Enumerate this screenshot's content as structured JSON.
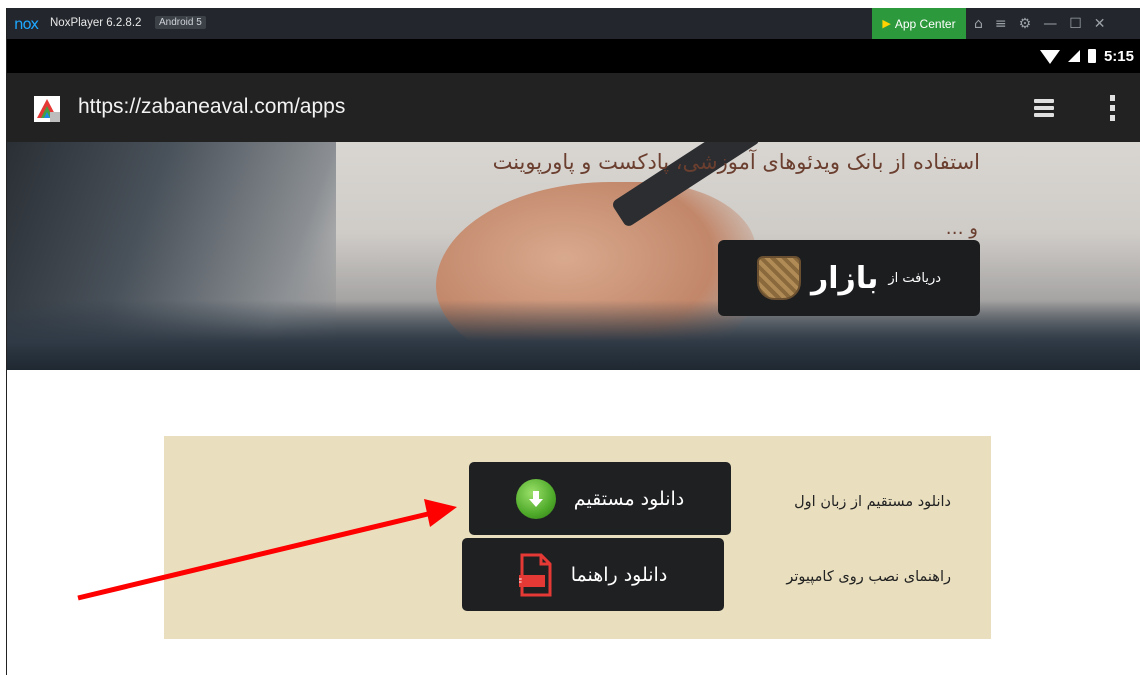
{
  "emulator": {
    "logo": "nox",
    "name": "NoxPlayer 6.2.8.2",
    "android_badge": "Android 5",
    "app_center_label": "App Center",
    "toolbar_icons": [
      "shirt-icon",
      "menu-icon",
      "settings-icon",
      "minimize-icon",
      "maximize-icon",
      "close-icon"
    ]
  },
  "status_bar": {
    "time": "5:15",
    "icons": [
      "wifi-icon",
      "signal-icon",
      "battery-icon"
    ]
  },
  "browser": {
    "url": "https://zabaneaval.com/apps",
    "icons": [
      "site-logo-icon",
      "tabs-icon",
      "overflow-menu-icon"
    ]
  },
  "hero": {
    "headline": "استفاده از بانک ویدئوهای آموزشی، پادکست و پاورپوینت",
    "continuation": "و …",
    "bazaar_button": {
      "prefix": "دریافت از",
      "brand": "بازار"
    }
  },
  "downloads": {
    "direct": {
      "description": "دانلود مستقیم از زبان اول",
      "button_label": "دانلود مستقیم"
    },
    "guide": {
      "description": "راهنمای نصب روی کامپیوتر",
      "button_label": "دانلود راهنما"
    }
  },
  "colors": {
    "app_center": "#2c9a3c",
    "panel": "#e9dfbf",
    "annotation_arrow": "#ff0000",
    "hero_text": "#6b3f2f"
  }
}
